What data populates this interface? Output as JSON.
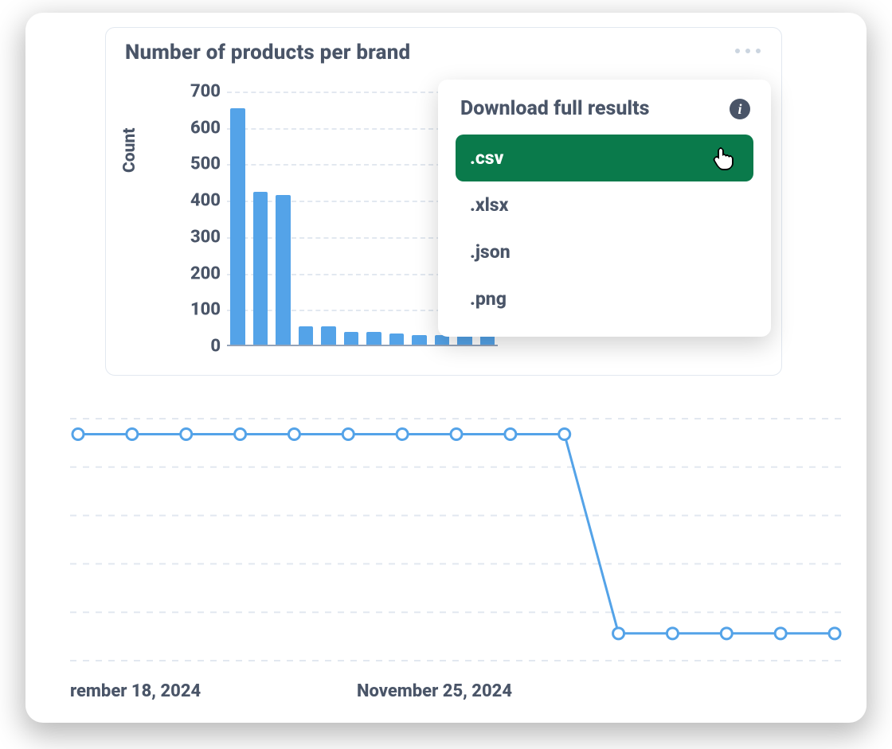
{
  "card": {
    "title": "Number of products per brand",
    "more_icon_name": "more-icon"
  },
  "download_popover": {
    "title": "Download full results",
    "info_icon_label": "i",
    "items": [
      {
        "label": ".csv",
        "active": true
      },
      {
        "label": ".xlsx",
        "active": false
      },
      {
        "label": ".json",
        "active": false
      },
      {
        "label": ".png",
        "active": false
      }
    ]
  },
  "chart_data": [
    {
      "type": "bar",
      "title": "Number of products per brand",
      "ylabel": "Count",
      "ylim": [
        0,
        700
      ],
      "yticks": [
        0,
        100,
        200,
        300,
        400,
        500,
        600,
        700
      ],
      "values": [
        655,
        425,
        415,
        55,
        55,
        40,
        40,
        35,
        30,
        30,
        30,
        30
      ]
    },
    {
      "type": "line",
      "x_labels_visible": [
        "rember 18, 2024",
        "November 25, 2024"
      ],
      "y": [
        100,
        100,
        100,
        100,
        100,
        100,
        100,
        100,
        100,
        100,
        15,
        15,
        15,
        15,
        15
      ],
      "ylim": [
        0,
        110
      ],
      "grid_rows": 6
    }
  ]
}
